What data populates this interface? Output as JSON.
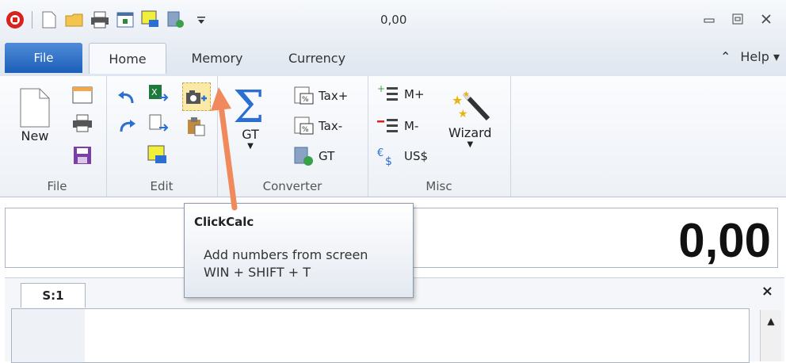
{
  "window": {
    "title": "0,00"
  },
  "tabs": {
    "file": "File",
    "home": "Home",
    "memory": "Memory",
    "currency": "Currency",
    "help": "Help"
  },
  "ribbon": {
    "file_group": {
      "label": "File",
      "new": "New"
    },
    "edit_group": {
      "label": "Edit"
    },
    "converter_group": {
      "label": "Converter",
      "gt_big": "GT",
      "tax_plus": "Tax+",
      "tax_minus": "Tax-",
      "gt_small": "GT"
    },
    "misc_group": {
      "label": "Misc",
      "m_plus": "M+",
      "m_minus": "M-",
      "uss": "US$",
      "wizard": "Wizard"
    }
  },
  "display": {
    "value": "0,00"
  },
  "tape": {
    "tab": "S:1",
    "close": "×"
  },
  "tooltip": {
    "title": "ClickCalc",
    "line1": "Add numbers from screen",
    "line2": "WIN + SHIFT + T"
  },
  "colors": {
    "file_tab": "#1c5fb8",
    "sigma": "#2a6fd1",
    "arrow": "#f08a5d"
  }
}
